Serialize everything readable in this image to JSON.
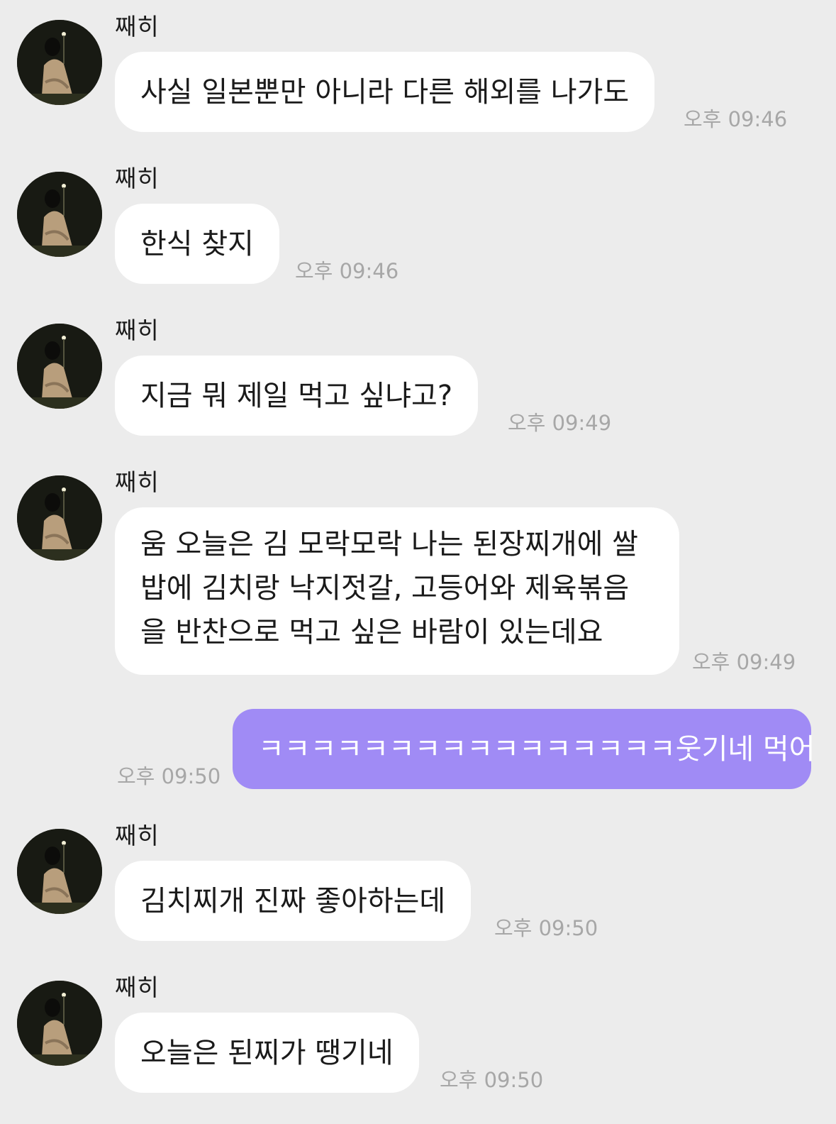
{
  "contact": {
    "name": "째히",
    "avatar_icon": "profile-photo-avatar"
  },
  "colors": {
    "background": "#ececec",
    "incoming_bubble": "#ffffff",
    "outgoing_bubble": "#a08bf5",
    "time_text": "#a7a7a7"
  },
  "messages": [
    {
      "sender": "째히",
      "text": "사실 일본뿐만 아니라 다른 해외를 나가도",
      "time": "오후 09:46",
      "outgoing": false
    },
    {
      "sender": "째히",
      "text": "한식 찾지",
      "time": "오후 09:46",
      "outgoing": false
    },
    {
      "sender": "째히",
      "text": "지금 뭐 제일 먹고 싶냐고?",
      "time": "오후 09:49",
      "outgoing": false
    },
    {
      "sender": "째히",
      "lines": [
        "움 오늘은 김 모락모락 나는 된장찌개에 쌀",
        "밥에 김치랑 낙지젓갈, 고등어와 제육볶음",
        "을 반찬으로 먹고 싶은 바람이 있는데요"
      ],
      "time": "오후 09:49",
      "outgoing": false
    },
    {
      "text": "ㅋㅋㅋㅋㅋㅋㅋㅋㅋㅋㅋㅋㅋㅋㅋㅋ웃기네 먹어",
      "time": "오후 09:50",
      "outgoing": true
    },
    {
      "sender": "째히",
      "text": "김치찌개 진짜 좋아하는데",
      "time": "오후 09:50",
      "outgoing": false
    },
    {
      "sender": "째히",
      "text": "오늘은 된찌가 땡기네",
      "time": "오후 09:50",
      "outgoing": false
    }
  ]
}
